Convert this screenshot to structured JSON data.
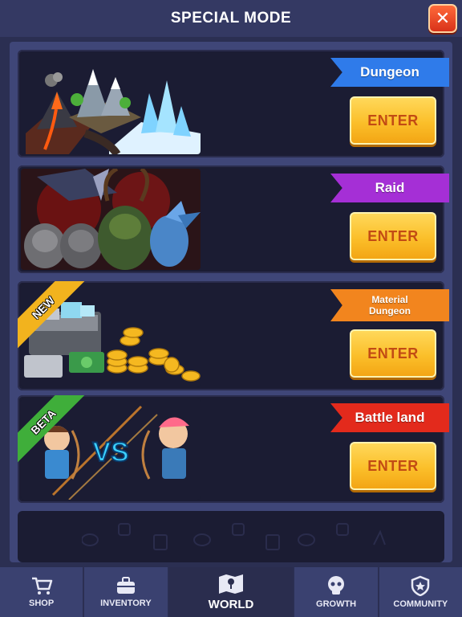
{
  "header": {
    "title": "SPECIAL MODE",
    "close_icon": "close-icon"
  },
  "modes": [
    {
      "name": "Dungeon",
      "button": "ENTER",
      "ribbon_color": "#2f7bea"
    },
    {
      "name": "Raid",
      "button": "ENTER",
      "ribbon_color": "#a52fd6"
    },
    {
      "name": "Material\nDungeon",
      "button": "ENTER",
      "ribbon_color": "#f2851e",
      "badge": "NEW"
    },
    {
      "name": "Battle land",
      "button": "ENTER",
      "ribbon_color": "#e32a1c",
      "badge": "BETA"
    }
  ],
  "art_labels": {
    "vs": "VS"
  },
  "nav": [
    {
      "label": "SHOP",
      "icon": "cart-icon"
    },
    {
      "label": "INVENTORY",
      "icon": "briefcase-icon"
    },
    {
      "label": "WORLD",
      "icon": "map-icon",
      "active": true
    },
    {
      "label": "GROWTH",
      "icon": "skull-icon"
    },
    {
      "label": "COMMUNITY",
      "icon": "shield-star-icon"
    }
  ],
  "colors": {
    "background": "#2b2f52",
    "panel": "#3f4678",
    "card": "#1b1c33",
    "enter_text": "#c24b14",
    "enter_bg": "#fbbf2a"
  }
}
